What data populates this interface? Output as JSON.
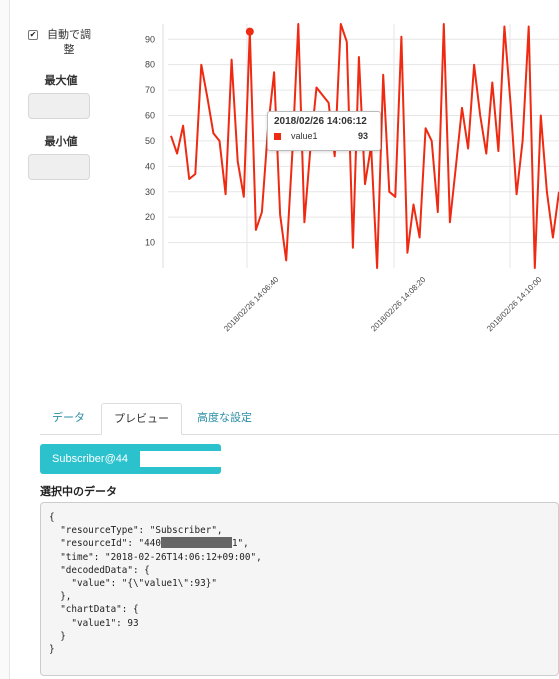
{
  "controls": {
    "auto_adjust_label": "自動で調整",
    "auto_adjust_checked": true,
    "max_label": "最大値",
    "max_value": "",
    "min_label": "最小値",
    "min_value": ""
  },
  "chart_data": {
    "type": "line",
    "series": [
      {
        "name": "value1",
        "color": "#ee2b12",
        "values": [
          52,
          45,
          56,
          35,
          37,
          80,
          67,
          53,
          50,
          29,
          82,
          42,
          28,
          93,
          15,
          22,
          55,
          77,
          21,
          3,
          45,
          96,
          18,
          47,
          71,
          68,
          65,
          44,
          96,
          89,
          8,
          83,
          33,
          48,
          0,
          76,
          30,
          28,
          91,
          6,
          25,
          12,
          55,
          50,
          22,
          96,
          18,
          40,
          63,
          47,
          80,
          60,
          45,
          73,
          46,
          95,
          65,
          29,
          50,
          95,
          0,
          60,
          30,
          12,
          30
        ]
      }
    ],
    "x_tick_labels": [
      "2018/02/26 14:06:40",
      "2018/02/26 14:08:20",
      "2018/02/26 14:10:00"
    ],
    "y_ticks": [
      10,
      20,
      30,
      40,
      50,
      60,
      70,
      80,
      90
    ],
    "ylim": [
      0,
      96
    ],
    "grid": true,
    "highlighted_point": {
      "index": 13,
      "value": 93
    }
  },
  "tooltip": {
    "title": "2018/02/26 14:06:12",
    "series_name": "value1",
    "value": "93"
  },
  "tabs": [
    {
      "label": "データ",
      "active": false
    },
    {
      "label": "プレビュー",
      "active": true
    },
    {
      "label": "高度な設定",
      "active": false
    }
  ],
  "subscriber_button": {
    "label": "Subscriber@44"
  },
  "selected_section": {
    "title": "選択中のデータ",
    "json_lines": [
      "{",
      "  \"resourceType\": \"Subscriber\",",
      "  \"resourceId\": \"440",
      "  \"time\": \"2018-02-26T14:06:12+09:00\",",
      "  \"decodedData\": {",
      "    \"value\": \"{\\\"value1\\\":93}\"",
      "  },",
      "  \"chartData\": {",
      "    \"value1\": 93",
      "  }",
      "}"
    ],
    "resource_id_suffix": "1\","
  }
}
